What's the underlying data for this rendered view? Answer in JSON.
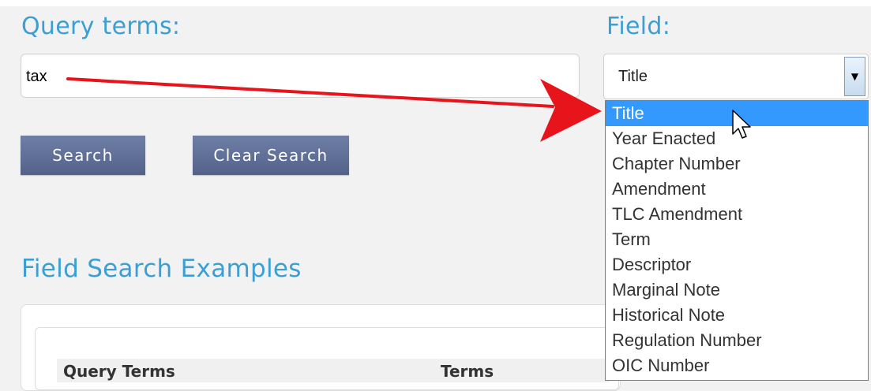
{
  "form": {
    "query_label": "Query terms:",
    "query_value": "tax",
    "field_label": "Field:",
    "field_selected": "Title",
    "search_button": "Search",
    "clear_button": "Clear Search"
  },
  "dropdown": {
    "options": [
      "Title",
      "Year Enacted",
      "Chapter Number",
      "Amendment",
      "TLC Amendment",
      "Term",
      "Descriptor",
      "Marginal Note",
      "Historical Note",
      "Regulation Number",
      "OIC Number"
    ],
    "highlighted": "Title"
  },
  "examples": {
    "title": "Field Search Examples",
    "columns": [
      "Query Terms",
      "Terms"
    ]
  },
  "colors": {
    "heading": "#3b9fd3",
    "button": "#5f6f98",
    "highlight": "#3399ff",
    "arrow": "#e8141c"
  },
  "icons": {
    "dropdown_arrow": "triangle-down",
    "annotation": "red-arrow",
    "pointer": "mouse-cursor"
  }
}
